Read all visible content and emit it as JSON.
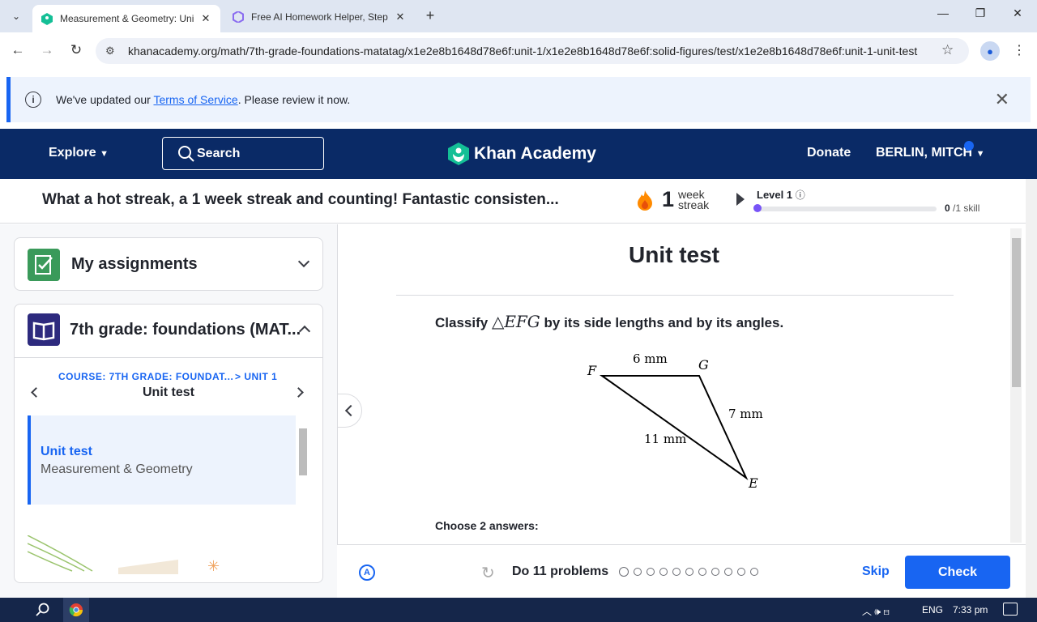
{
  "browser": {
    "tabs": [
      {
        "title": "Measurement & Geometry: Uni",
        "active": true
      },
      {
        "title": "Free AI Homework Helper, Step",
        "active": false
      }
    ],
    "url": "khanacademy.org/math/7th-grade-foundations-matatag/x1e2e8b1648d78e6f:unit-1/x1e2e8b1648d78e6f:solid-figures/test/x1e2e8b1648d78e6f:unit-1-unit-test"
  },
  "banner": {
    "prefix": "We've updated our ",
    "link": "Terms of Service",
    "suffix": ". Please review it now."
  },
  "header": {
    "explore": "Explore",
    "search": "Search",
    "logo": "Khan Academy",
    "donate": "Donate",
    "user": "BERLIN, MITCH"
  },
  "streak": {
    "message": "What a hot streak, a 1 week streak and counting! Fantastic consisten...",
    "count": "1",
    "unit_line1": "week",
    "unit_line2": "streak",
    "level": "Level 1",
    "skills_done": "0",
    "skills_total": " /1 skill",
    "level_progress": 0
  },
  "sidebar": {
    "assignments": "My assignments",
    "course": "7th grade: foundations (MAT...",
    "crumb_course": "COURSE: 7TH GRADE: FOUNDAT...",
    "crumb_unit": "> UNIT 1",
    "crumb_title": "Unit test",
    "active_title": "Unit test",
    "active_subtitle": "Measurement & Geometry"
  },
  "main": {
    "title": "Unit test",
    "question_prefix": "Classify ",
    "question_math": "△EFG",
    "question_suffix": " by its side lengths and by its angles.",
    "choose": "Choose 2 answers:",
    "diagram": {
      "labels": {
        "F": "F",
        "G": "G",
        "E": "E"
      },
      "sides": {
        "FG": "6 mm",
        "GE": "7 mm",
        "FE": "11 mm"
      }
    }
  },
  "footer": {
    "problems": "Do 11 problems",
    "problem_count": 11,
    "skip": "Skip",
    "check": "Check"
  },
  "taskbar": {
    "lang": "ENG",
    "time": "7:33 pm"
  },
  "colors": {
    "accent": "#1865f2",
    "header": "#0a2a66",
    "level": "#7854f7"
  }
}
